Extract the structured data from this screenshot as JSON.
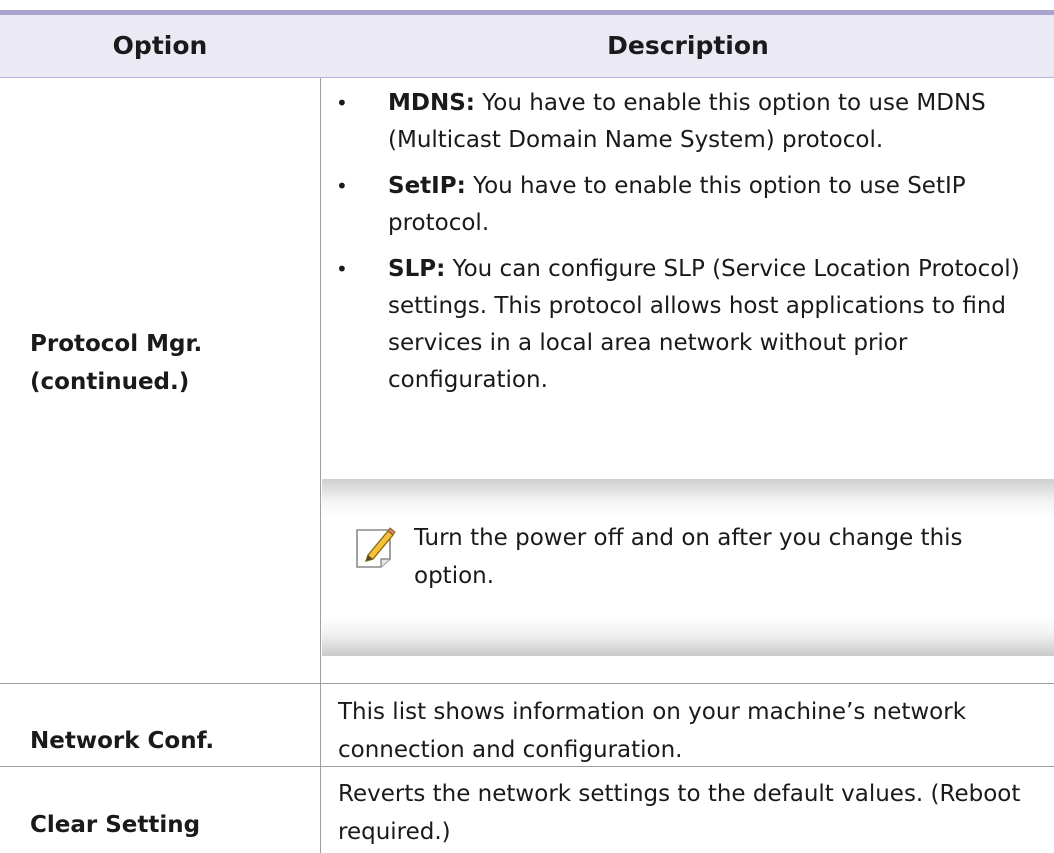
{
  "table": {
    "headers": {
      "option": "Option",
      "description": "Description"
    },
    "rows": [
      {
        "option_lines": [
          "Protocol Mgr.",
          "(continued.)"
        ],
        "bullets": [
          {
            "term": "MDNS:",
            "text": " You have to enable this option to use MDNS (Multicast Domain Name System) protocol."
          },
          {
            "term": "SetIP:",
            "text": " You have to enable this option to use SetIP protocol."
          },
          {
            "term": "SLP:",
            "text": " You can configure SLP (Service Location Protocol) settings. This protocol allows host applications to find services in a local area network without prior configuration."
          }
        ],
        "note": "Turn the power off and on after you change this option."
      },
      {
        "option": "Network Conf.",
        "description": "This list shows information on your machine’s network connection and configuration."
      },
      {
        "option": "Clear Setting",
        "description": "Reverts the network settings to the default values. (Reboot required.)"
      }
    ]
  },
  "colors": {
    "header_bg": "#eae9f4",
    "top_rule": "#a9a3d0",
    "divider": "#9d9d9d"
  },
  "icons": {
    "note": "note-pencil-icon",
    "bullet": "bullet-dot"
  }
}
